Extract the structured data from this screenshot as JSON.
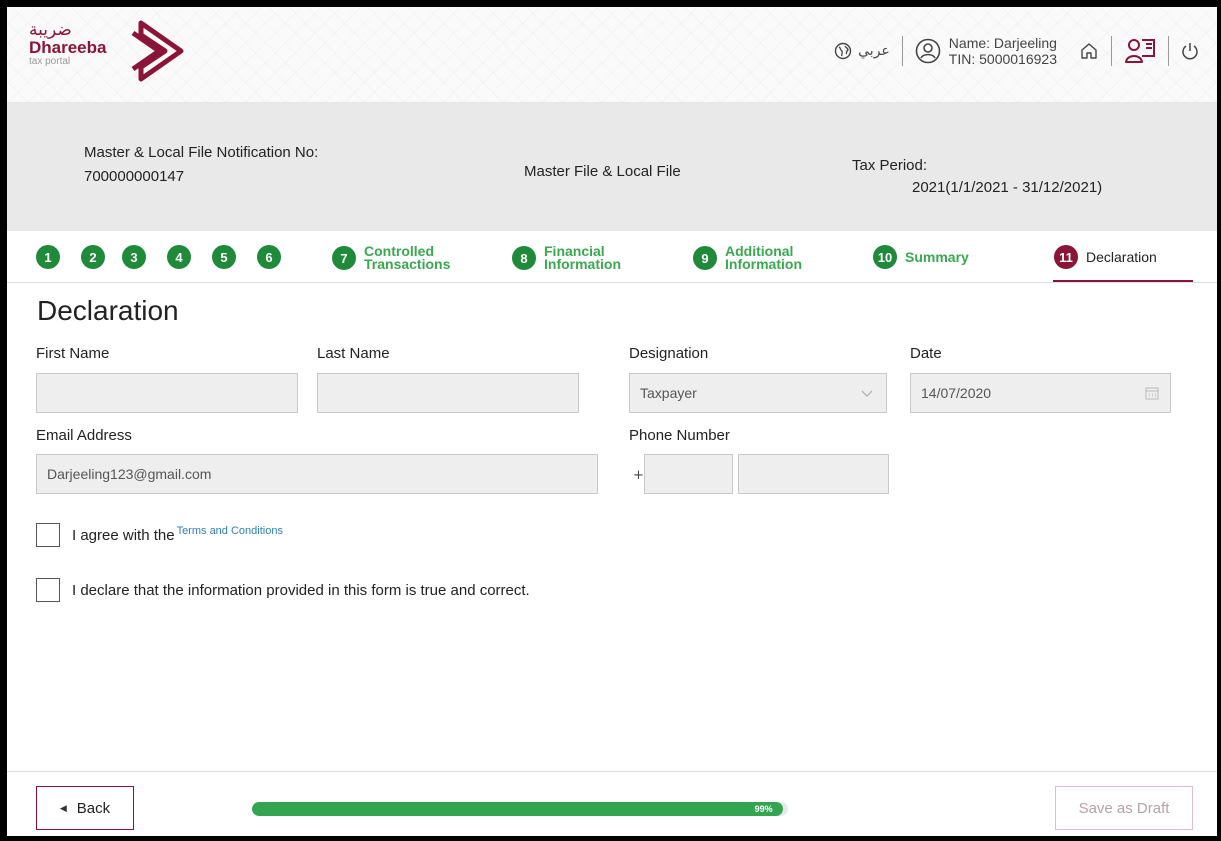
{
  "header": {
    "logo_arabic": "ضريبة",
    "logo_name": "Dhareeba",
    "logo_sub": "tax portal",
    "language": "عربي",
    "user_name": "Name: Darjeeling",
    "user_tin": "TIN: 5000016923",
    "icons": [
      "globe-icon",
      "user-icon",
      "home-icon",
      "user-book-icon",
      "power-icon"
    ]
  },
  "info": {
    "notification_label": "Master & Local File Notification No:",
    "notification_no": "700000000147",
    "file_type": "Master File & Local File",
    "tax_period_label": "Tax Period:",
    "tax_period": "2021(1/1/2021 - 31/12/2021)"
  },
  "steps": [
    {
      "num": "1",
      "label": ""
    },
    {
      "num": "2",
      "label": ""
    },
    {
      "num": "3",
      "label": ""
    },
    {
      "num": "4",
      "label": ""
    },
    {
      "num": "5",
      "label": ""
    },
    {
      "num": "6",
      "label": ""
    },
    {
      "num": "7",
      "label_line1": "Controlled",
      "label_line2": "Transactions"
    },
    {
      "num": "8",
      "label_line1": "Financial",
      "label_line2": "Information"
    },
    {
      "num": "9",
      "label_line1": "Additional",
      "label_line2": "Information"
    },
    {
      "num": "10",
      "label": "Summary"
    },
    {
      "num": "11",
      "label": "Declaration"
    }
  ],
  "form": {
    "title": "Declaration",
    "first_name_label": "First Name",
    "first_name_value": "",
    "last_name_label": "Last Name",
    "last_name_value": "",
    "designation_label": "Designation",
    "designation_value": "Taxpayer",
    "date_label": "Date",
    "date_value": "14/07/2020",
    "email_label": "Email Address",
    "email_value": "Darjeeling123@gmail.com",
    "phone_label": "Phone Number",
    "phone_prefix": "+",
    "phone_code": "",
    "phone_number": "",
    "terms_text": "I agree with the",
    "terms_link": "Terms and Conditions",
    "declare_text": "I declare that the information provided in this form is true and correct."
  },
  "footer": {
    "back_label": "Back",
    "progress_label": "99%",
    "progress_value": 0.99,
    "save_draft_label": "Save as Draft"
  },
  "colors": {
    "brand": "#8a1538",
    "step_green": "#1e8a3a",
    "progress_green": "#33a452",
    "link_blue": "#2f7fb5"
  }
}
